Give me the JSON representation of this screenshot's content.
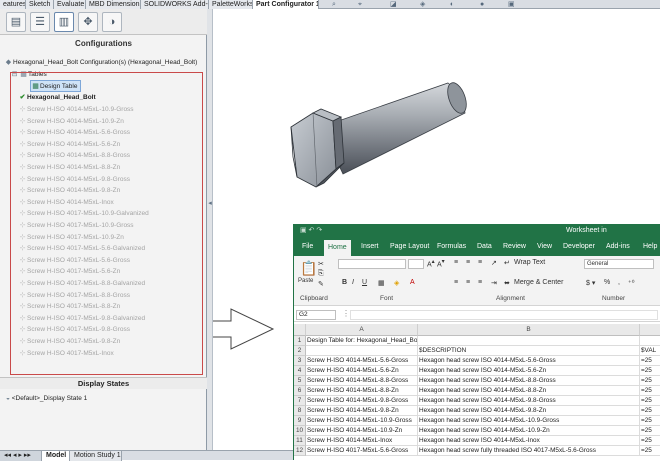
{
  "top_tabs": [
    "eatures",
    "Sketch",
    "Evaluate",
    "MBD Dimensions",
    "SOLIDWORKS Add-Ins",
    "PaletteWorks",
    "Part Configurator 1"
  ],
  "active_top_tab": "Part Configurator 1",
  "left_panel": {
    "configurations_header": "Configurations",
    "root_label": "Hexagonal_Head_Bolt Configuration(s)  (Hexagonal_Head_Bolt)",
    "tables_label": "Tables",
    "design_table_label": "Design Table",
    "active_config": "Hexagonal_Head_Bolt",
    "configs": [
      "Screw H-ISO 4014-M5xL-10.9-Gross",
      "Screw H-ISO 4014-M5xL-10.9-Zn",
      "Screw H-ISO 4014-M5xL-5.6-Gross",
      "Screw H-ISO 4014-M5xL-5.6-Zn",
      "Screw H-ISO 4014-M5xL-8.8-Gross",
      "Screw H-ISO 4014-M5xL-8.8-Zn",
      "Screw H-ISO 4014-M5xL-9.8-Gross",
      "Screw H-ISO 4014-M5xL-9.8-Zn",
      "Screw H-ISO 4014-M5xL-Inox",
      "Screw H-ISO 4017-M5xL-10.9-Galvanized",
      "Screw H-ISO 4017-M5xL-10.9-Gross",
      "Screw H-ISO 4017-M5xL-10.9-Zn",
      "Screw H-ISO 4017-M5xL-5.6-Galvanized",
      "Screw H-ISO 4017-M5xL-5.6-Gross",
      "Screw H-ISO 4017-M5xL-5.6-Zn",
      "Screw H-ISO 4017-M5xL-8.8-Galvanized",
      "Screw H-ISO 4017-M5xL-8.8-Gross",
      "Screw H-ISO 4017-M5xL-8.8-Zn",
      "Screw H-ISO 4017-M5xL-9.8-Galvanized",
      "Screw H-ISO 4017-M5xL-9.8-Gross",
      "Screw H-ISO 4017-M5xL-9.8-Zn",
      "Screw H-ISO 4017-M5xL-Inox"
    ],
    "display_states_header": "Display States",
    "display_state_row": "<Default>_Display State 1"
  },
  "bottom_tabs": [
    "Model",
    "Motion Study 1"
  ],
  "active_bottom_tab": "Model",
  "excel": {
    "title": "Worksheet in Hexagonal_Head_Bolt",
    "tabs": [
      "File",
      "Home",
      "Insert",
      "Page Layout",
      "Formulas",
      "Data",
      "Review",
      "View",
      "Developer",
      "Add-ins",
      "Help"
    ],
    "active_tab": "Home",
    "ribbon": {
      "clipboard": "Clipboard",
      "font": "Font",
      "alignment": "Alignment",
      "number": "Number",
      "paste": "Paste",
      "wrap_text": "Wrap Text",
      "merge_center": "Merge & Center",
      "number_format": "General",
      "bold": "B",
      "italic": "I",
      "underline": "U"
    },
    "name_box": "G2",
    "columns": [
      "A",
      "B",
      ""
    ],
    "rows": [
      {
        "num": "1",
        "a": "Design Table for: Hexagonal_Head_Bolt",
        "b": "",
        "c": ""
      },
      {
        "num": "2",
        "a": "",
        "b": "$DESCRIPTION",
        "c": "$VAL"
      },
      {
        "num": "3",
        "a": "Screw H-ISO 4014-M5xL-5.6-Gross",
        "b": "Hexagon head screw ISO 4014-M5xL-5.6-Gross",
        "c": "=25"
      },
      {
        "num": "4",
        "a": "Screw H-ISO 4014-M5xL-5.6-Zn",
        "b": "Hexagon head screw ISO 4014-M5xL-5.6-Zn",
        "c": "=25"
      },
      {
        "num": "5",
        "a": "Screw H-ISO 4014-M5xL-8.8-Gross",
        "b": "Hexagon head screw ISO 4014-M5xL-8.8-Gross",
        "c": "=25"
      },
      {
        "num": "6",
        "a": "Screw H-ISO 4014-M5xL-8.8-Zn",
        "b": "Hexagon head screw ISO 4014-M5xL-8.8-Zn",
        "c": "=25"
      },
      {
        "num": "7",
        "a": "Screw H-ISO 4014-M5xL-9.8-Gross",
        "b": "Hexagon head screw ISO 4014-M5xL-9.8-Gross",
        "c": "=25"
      },
      {
        "num": "8",
        "a": "Screw H-ISO 4014-M5xL-9.8-Zn",
        "b": "Hexagon head screw ISO 4014-M5xL-9.8-Zn",
        "c": "=25"
      },
      {
        "num": "9",
        "a": "Screw H-ISO 4014-M5xL-10.9-Gross",
        "b": "Hexagon head screw ISO 4014-M5xL-10.9-Gross",
        "c": "=25"
      },
      {
        "num": "10",
        "a": "Screw H-ISO 4014-M5xL-10.9-Zn",
        "b": "Hexagon head screw ISO 4014-M5xL-10.9-Zn",
        "c": "=25"
      },
      {
        "num": "11",
        "a": "Screw H-ISO 4014-M5xL-Inox",
        "b": "Hexagon head screw ISO 4014-M5xL-Inox",
        "c": "=25"
      },
      {
        "num": "12",
        "a": "Screw H-ISO 4017-M5xL-5.6-Gross",
        "b": "Hexagon head screw fully threaded ISO 4017-M5xL-5.6-Gross",
        "c": "=25"
      }
    ],
    "colors": {
      "header": "#217346",
      "accent": "#217346"
    }
  }
}
